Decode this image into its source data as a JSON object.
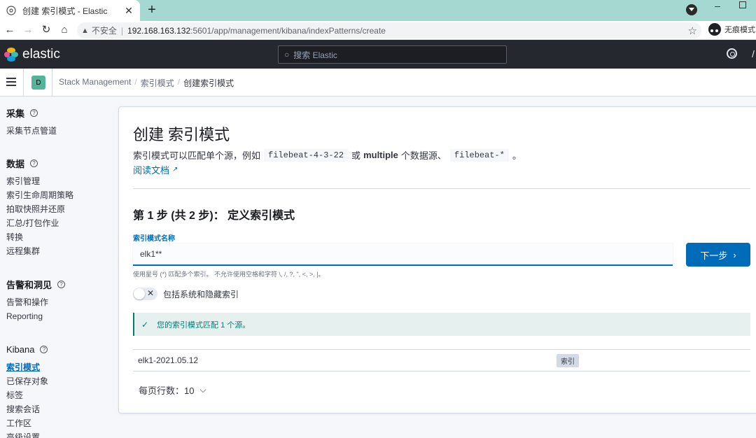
{
  "browser": {
    "tab_title": "创建 索引模式 - Elastic",
    "tab_close": "✕",
    "new_tab": "+",
    "insecure_label": "不安全",
    "url_host": "192.168.163.132",
    "url_rest": ":5601/app/management/kibana/indexPatterns/create",
    "incognito_label": "无痕模式"
  },
  "kibana": {
    "logo_text": "elastic",
    "search_placeholder": "搜索 Elastic",
    "space_initial": "D"
  },
  "breadcrumb": {
    "items": [
      "Stack Management",
      "索引模式",
      "创建索引模式"
    ],
    "separator": "/"
  },
  "sidebar": {
    "groups": [
      {
        "title": "采集",
        "items": [
          "采集节点管道"
        ]
      },
      {
        "title": "数据",
        "items": [
          "索引管理",
          "索引生命周期策略",
          "拍取快照并还原",
          "汇总/打包作业",
          "转换",
          "远程集群"
        ]
      },
      {
        "title": "告警和洞见",
        "items": [
          "告警和操作",
          "Reporting"
        ]
      },
      {
        "title": "Kibana",
        "items": [
          "索引模式",
          "已保存对象",
          "标签",
          "搜索会话",
          "工作区",
          "高级设置"
        ]
      }
    ],
    "active_item": "索引模式"
  },
  "main": {
    "title": "创建 索引模式",
    "desc_prefix": "索引模式可以匹配单个源，例如",
    "desc_code1": "filebeat-4-3-22",
    "desc_or": "或",
    "desc_bold": "multiple",
    "desc_mid": "个数据源、",
    "desc_code2": "filebeat-*",
    "desc_end": "。",
    "doc_link": "阅读文档",
    "step_title": "第 1 步 (共 2 步)： 定义索引模式",
    "field_label": "索引模式名称",
    "field_value": "elk1**",
    "next_button": "下一步",
    "help_text": "使用星号 (*) 匹配多个索引。 不允许使用空格和字符 \\, /, ?, \", <, >, |。",
    "toggle_label": "包括系统和隐藏索引",
    "callout_text": "您的索引模式匹配 1 个源。",
    "table_rows": [
      {
        "name": "elk1-2021.05.12",
        "badge": "索引"
      }
    ],
    "pager_label": "每页行数：10"
  },
  "colors": {
    "accent": "#006bb8",
    "header_bg": "#25282f",
    "success": "#017d73",
    "tabstrip": "#a5d8d0"
  }
}
